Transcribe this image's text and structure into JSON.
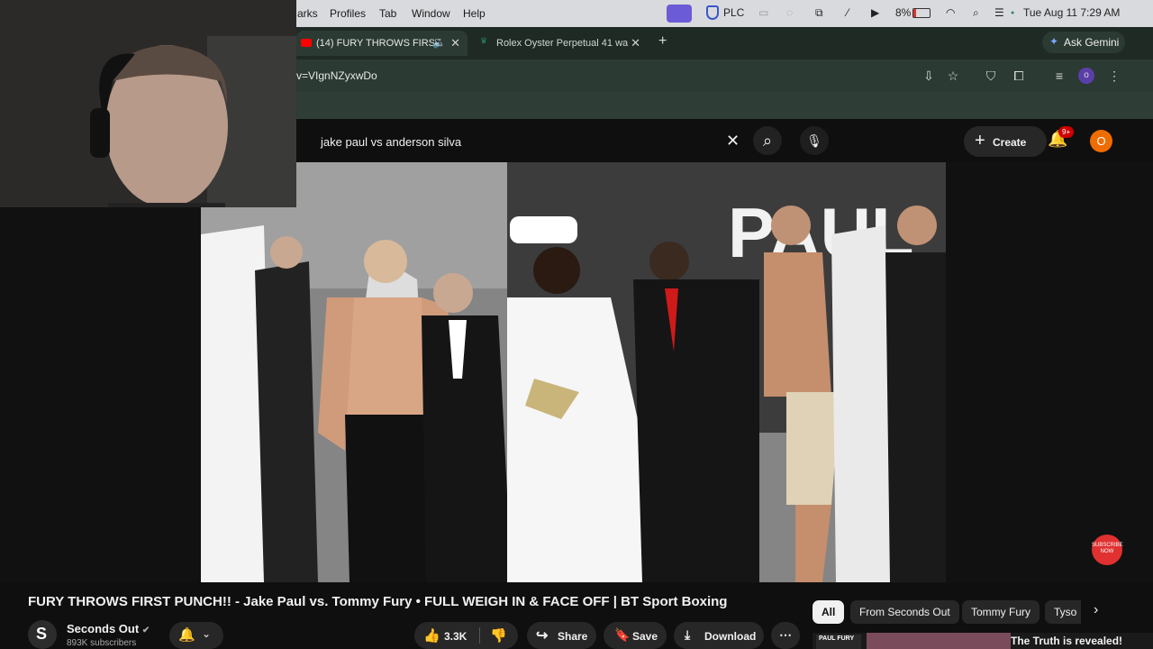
{
  "menubar": {
    "items": [
      "arks",
      "Profiles",
      "Tab",
      "Window",
      "Help"
    ],
    "app_badge": "PLC",
    "battery": "8%",
    "datetime": "Tue Aug 11  7:29 AM"
  },
  "tabs": [
    {
      "label": "(14) FURY THROWS FIRST"
    },
    {
      "label": "Rolex Oyster Perpetual 41 wa"
    }
  ],
  "ask_gemini": "Ask Gemini",
  "address": {
    "url": "v=VIgnNZyxwDo",
    "profile_initial": "o"
  },
  "search": {
    "query": "jake paul vs anderson silva"
  },
  "header": {
    "create_label": "Create",
    "notifications_badge": "9+",
    "avatar_initial": "O"
  },
  "video": {
    "title": "FURY THROWS FIRST PUNCH!! - Jake Paul vs. Tommy Fury • FULL WEIGH IN & FACE OFF | BT Sport Boxing",
    "backdrop_text": "PAUL",
    "subscribe_watermark": "SUBSCRIBE NOW"
  },
  "channel": {
    "name": "Seconds Out",
    "subscribers": "893K subscribers",
    "logo_letter": "S"
  },
  "actions": {
    "likes": "3.3K",
    "share": "Share",
    "save": "Save",
    "download": "Download"
  },
  "chips": [
    "All",
    "From Seconds Out",
    "Tommy Fury",
    "Tyso"
  ],
  "recommended": {
    "title": "The Truth is revealed!",
    "thumb_text": "PAUL FURY"
  },
  "colors": {
    "youtube_red": "#ff0000",
    "badge_red": "#cc0000",
    "avatar_orange": "#ef6c00",
    "chrome_tab": "#2b3a33"
  }
}
